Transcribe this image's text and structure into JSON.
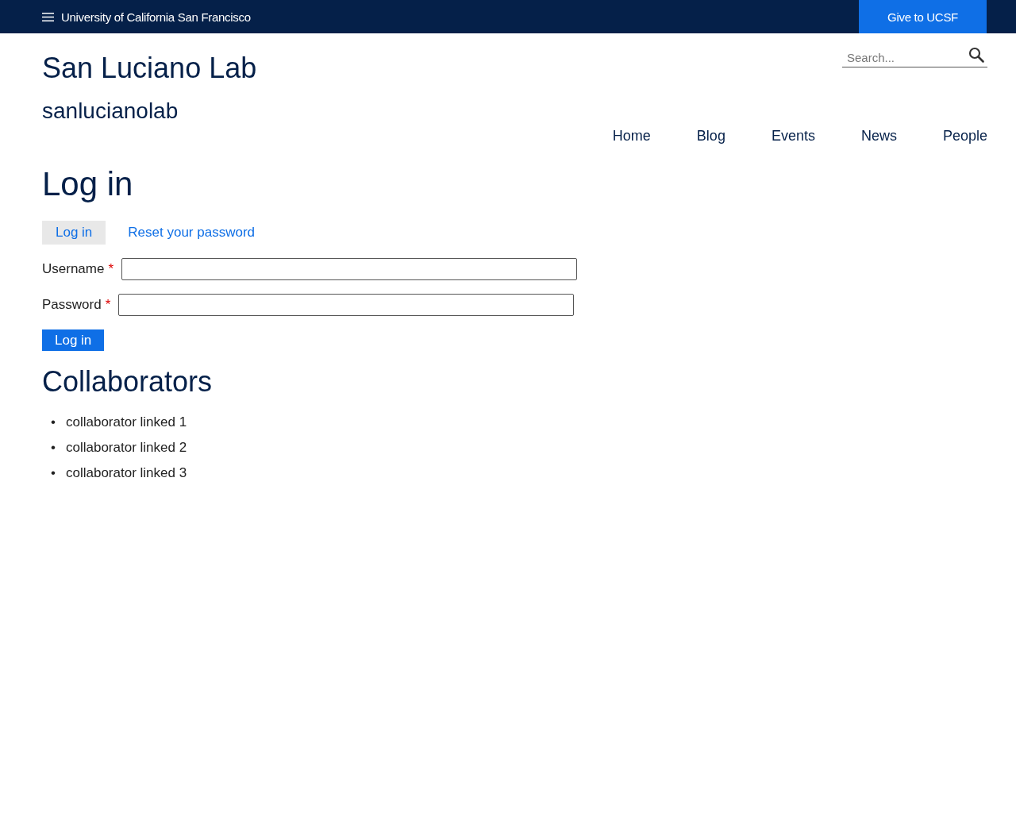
{
  "top_bar": {
    "brand": "University of California San Francisco",
    "give_button": "Give to UCSF"
  },
  "header": {
    "site_name": "San Luciano Lab",
    "slogan": "sanlucianolab",
    "search": {
      "placeholder": "Search..."
    }
  },
  "nav": [
    {
      "label": "Home"
    },
    {
      "label": "Blog"
    },
    {
      "label": "Events"
    },
    {
      "label": "News"
    },
    {
      "label": "People"
    }
  ],
  "page_title": "Log in",
  "tabs": [
    {
      "label": "Log in",
      "selected": true
    },
    {
      "label": "Reset your password",
      "selected": false
    }
  ],
  "form": {
    "fields": [
      {
        "label": "Username",
        "required_mark": "*"
      },
      {
        "label": "Password",
        "required_mark": "*"
      }
    ],
    "submit": "Log in"
  },
  "collaborators": {
    "title": "Collaborators",
    "items": [
      {
        "marker": "•",
        "text": "collaborator linked 1"
      },
      {
        "marker": "•",
        "text": "collaborator linked 2"
      },
      {
        "marker": "•",
        "text": "collaborator linked 3"
      }
    ]
  }
}
